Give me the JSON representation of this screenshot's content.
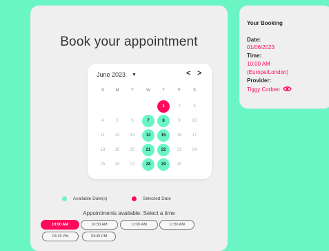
{
  "booking_form": {
    "title": "Book your appointment",
    "month_label": "June 2023",
    "prev_label": "<",
    "next_label": ">",
    "weekdays": [
      "S",
      "M",
      "T",
      "W",
      "T",
      "F",
      "S"
    ],
    "weeks": [
      [
        {
          "d": "",
          "s": "empty"
        },
        {
          "d": "",
          "s": "empty"
        },
        {
          "d": "",
          "s": "empty"
        },
        {
          "d": "",
          "s": "empty"
        },
        {
          "d": "1",
          "s": "selected"
        },
        {
          "d": "2",
          "s": "disabled"
        },
        {
          "d": "3",
          "s": "disabled"
        }
      ],
      [
        {
          "d": "4",
          "s": "disabled"
        },
        {
          "d": "5",
          "s": "disabled"
        },
        {
          "d": "6",
          "s": "disabled"
        },
        {
          "d": "7",
          "s": "available"
        },
        {
          "d": "8",
          "s": "available"
        },
        {
          "d": "9",
          "s": "disabled"
        },
        {
          "d": "10",
          "s": "disabled"
        }
      ],
      [
        {
          "d": "11",
          "s": "disabled"
        },
        {
          "d": "12",
          "s": "disabled"
        },
        {
          "d": "13",
          "s": "disabled"
        },
        {
          "d": "14",
          "s": "available"
        },
        {
          "d": "15",
          "s": "available"
        },
        {
          "d": "16",
          "s": "disabled"
        },
        {
          "d": "17",
          "s": "disabled"
        }
      ],
      [
        {
          "d": "18",
          "s": "disabled"
        },
        {
          "d": "19",
          "s": "disabled"
        },
        {
          "d": "20",
          "s": "disabled"
        },
        {
          "d": "21",
          "s": "available"
        },
        {
          "d": "22",
          "s": "available"
        },
        {
          "d": "23",
          "s": "disabled"
        },
        {
          "d": "24",
          "s": "disabled"
        }
      ],
      [
        {
          "d": "25",
          "s": "disabled"
        },
        {
          "d": "26",
          "s": "disabled"
        },
        {
          "d": "27",
          "s": "disabled"
        },
        {
          "d": "28",
          "s": "available"
        },
        {
          "d": "29",
          "s": "available"
        },
        {
          "d": "30",
          "s": "disabled"
        },
        {
          "d": "",
          "s": "empty"
        }
      ]
    ],
    "legend": {
      "available_label": "Available Date(s)",
      "selected_label": "Selected Date"
    },
    "availability_text": "Appointments available: Select a time",
    "time_slots": [
      {
        "label": "10:00 AM",
        "selected": true
      },
      {
        "label": "10:30 AM",
        "selected": false
      },
      {
        "label": "11:00 AM",
        "selected": false
      },
      {
        "label": "11:30 AM",
        "selected": false
      },
      {
        "label": "03:15 PM",
        "selected": false
      },
      {
        "label": "03:45 PM",
        "selected": false
      }
    ]
  },
  "summary": {
    "heading": "Your Booking",
    "date_label": "Date:",
    "date_value": "01/06/2023",
    "time_label": "Time:",
    "time_value": "10:00 AM",
    "timezone_value": "(Europe/London)",
    "provider_label": "Provider:",
    "provider_value": "Tiggy Corben"
  },
  "colors": {
    "background": "#6af5c5",
    "accent": "#ff0a5a",
    "available": "#6af5c5",
    "card": "#efefef"
  },
  "icons": {
    "month_dropdown": "caret-down-icon",
    "prev": "chevron-left-icon",
    "next": "chevron-right-icon",
    "provider": "eye-icon"
  }
}
